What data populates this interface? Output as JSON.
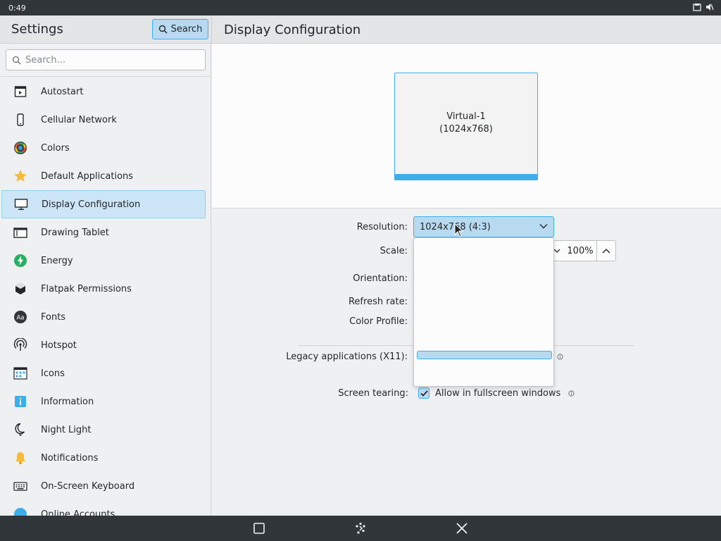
{
  "status_bar": {
    "time": "0:49"
  },
  "header": {
    "app_title": "Settings",
    "search_button": "Search",
    "page_title": "Display Configuration"
  },
  "sidebar": {
    "search_placeholder": "Search...",
    "items": [
      {
        "label": "Autostart",
        "icon": "autostart-icon"
      },
      {
        "label": "Cellular Network",
        "icon": "phone-icon"
      },
      {
        "label": "Colors",
        "icon": "colors-icon"
      },
      {
        "label": "Default Applications",
        "icon": "star-icon"
      },
      {
        "label": "Display Configuration",
        "icon": "display-icon",
        "selected": true
      },
      {
        "label": "Drawing Tablet",
        "icon": "tablet-icon"
      },
      {
        "label": "Energy",
        "icon": "energy-icon"
      },
      {
        "label": "Flatpak Permissions",
        "icon": "flatpak-icon"
      },
      {
        "label": "Fonts",
        "icon": "fonts-icon"
      },
      {
        "label": "Hotspot",
        "icon": "hotspot-icon"
      },
      {
        "label": "Icons",
        "icon": "icons-icon"
      },
      {
        "label": "Information",
        "icon": "information-icon"
      },
      {
        "label": "Night Light",
        "icon": "night-light-icon"
      },
      {
        "label": "Notifications",
        "icon": "bell-icon"
      },
      {
        "label": "On-Screen Keyboard",
        "icon": "keyboard-icon"
      },
      {
        "label": "Online Accounts",
        "icon": "online-accounts-icon"
      }
    ]
  },
  "display": {
    "monitor_name": "Virtual-1",
    "monitor_resolution": "(1024x768)",
    "labels": {
      "resolution": "Resolution:",
      "scale": "Scale:",
      "orientation": "Orientation:",
      "refresh_rate": "Refresh rate:",
      "color_profile": "Color Profile:",
      "legacy": "Legacy applications (X11):",
      "screen_tearing": "Screen tearing:"
    },
    "resolution_value": "1024x768 (4:3)",
    "scale_value": "100%",
    "screen_tearing_option": "Allow in fullscreen windows",
    "screen_tearing_checked": true
  },
  "colors": {
    "accent": "#3daee9",
    "selection": "#b7daf1",
    "dark_bar": "#31363b"
  }
}
